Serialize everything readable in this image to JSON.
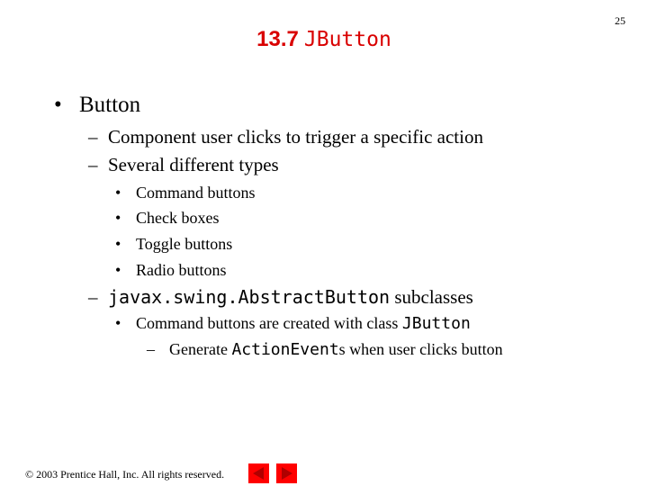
{
  "slide": {
    "page_number": "25",
    "title_number": "13.7",
    "title_code": "JButton",
    "bullets": [
      {
        "level": 1,
        "marker": "•",
        "text": "Button"
      },
      {
        "level": 2,
        "marker": "–",
        "text": "Component user clicks to trigger a specific action"
      },
      {
        "level": 2,
        "marker": "–",
        "text": "Several different types"
      },
      {
        "level": 3,
        "marker": "•",
        "text": "Command buttons"
      },
      {
        "level": 3,
        "marker": "•",
        "text": "Check boxes"
      },
      {
        "level": 3,
        "marker": "•",
        "text": "Toggle buttons"
      },
      {
        "level": 3,
        "marker": "•",
        "text": "Radio buttons"
      }
    ],
    "subclass_line": {
      "marker": "–",
      "code": "javax.swing.AbstractButton",
      "text": " subclasses"
    },
    "jbutton_line": {
      "marker": "•",
      "text": "Command buttons are created with class ",
      "code": "JButton"
    },
    "action_line": {
      "marker": "–",
      "prefix": "Generate ",
      "code": "ActionEvent",
      "suffix": "s when user clicks button"
    }
  },
  "footer": {
    "copyright": "© 2003 Prentice Hall, Inc.  All rights reserved."
  },
  "nav": {
    "prev_icon": "left-triangle-icon",
    "next_icon": "right-triangle-icon",
    "button_color": "#ff0000",
    "arrow_color": "#b00000"
  }
}
